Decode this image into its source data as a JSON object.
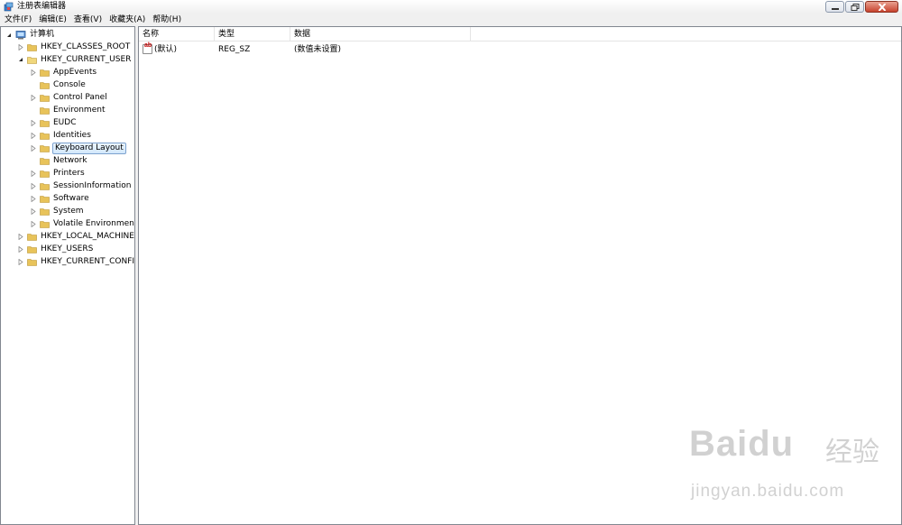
{
  "window": {
    "title": "注册表编辑器",
    "icon": "regedit-icon"
  },
  "menu": [
    {
      "label": "文件(F)"
    },
    {
      "label": "编辑(E)"
    },
    {
      "label": "查看(V)"
    },
    {
      "label": "收藏夹(A)"
    },
    {
      "label": "帮助(H)"
    }
  ],
  "tree": {
    "root": {
      "label": "计算机",
      "expanded": true
    },
    "hives": [
      {
        "label": "HKEY_CLASSES_ROOT",
        "expanded": false
      },
      {
        "label": "HKEY_CURRENT_USER",
        "expanded": true
      },
      {
        "label": "HKEY_LOCAL_MACHINE",
        "expanded": false
      },
      {
        "label": "HKEY_USERS",
        "expanded": false
      },
      {
        "label": "HKEY_CURRENT_CONFIG",
        "expanded": false
      }
    ],
    "current_user_children": [
      {
        "label": "AppEvents",
        "has_children": true
      },
      {
        "label": "Console",
        "has_children": false
      },
      {
        "label": "Control Panel",
        "has_children": true
      },
      {
        "label": "Environment",
        "has_children": false
      },
      {
        "label": "EUDC",
        "has_children": true
      },
      {
        "label": "Identities",
        "has_children": true
      },
      {
        "label": "Keyboard Layout",
        "has_children": true,
        "selected": true
      },
      {
        "label": "Network",
        "has_children": false
      },
      {
        "label": "Printers",
        "has_children": true
      },
      {
        "label": "SessionInformation",
        "has_children": true
      },
      {
        "label": "Software",
        "has_children": true
      },
      {
        "label": "System",
        "has_children": true
      },
      {
        "label": "Volatile Environment",
        "has_children": true
      }
    ]
  },
  "list": {
    "columns": [
      "名称",
      "类型",
      "数据"
    ],
    "rows": [
      {
        "name": "(默认)",
        "type": "REG_SZ",
        "data": "(数值未设置)",
        "icon": "string-value-icon"
      }
    ]
  },
  "watermark": {
    "logo": "Bai",
    "logo2": "du",
    "jingyan": "经验",
    "url": "jingyan.baidu.com"
  },
  "colors": {
    "selection_border": "#7da2ce",
    "folder": "#e8c35a",
    "pane_border": "#828790"
  }
}
